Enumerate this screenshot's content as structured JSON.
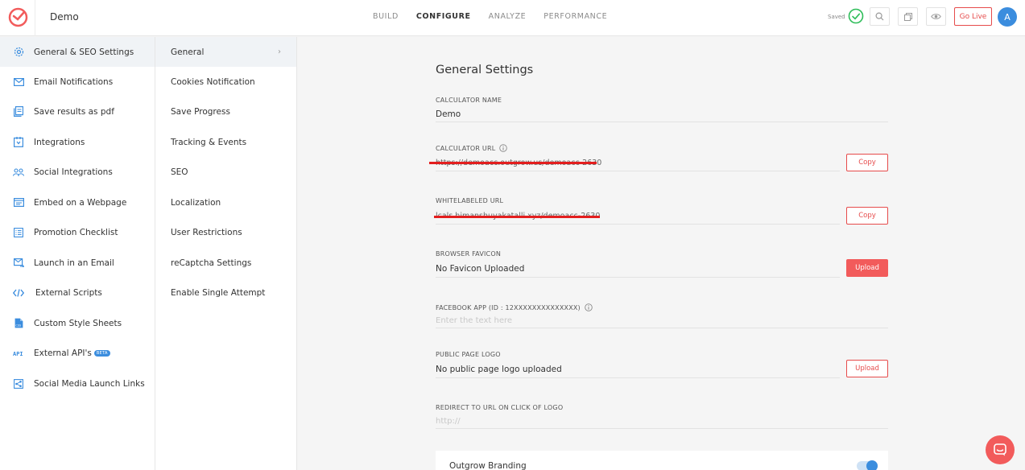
{
  "header": {
    "app_name": "Demo",
    "nav": [
      "BUILD",
      "CONFIGURE",
      "ANALYZE",
      "PERFORMANCE"
    ],
    "active_nav": "CONFIGURE",
    "saved": "Saved",
    "go_live": "Go Live",
    "avatar_initial": "A"
  },
  "sidebar": {
    "items": [
      {
        "label": "General & SEO Settings",
        "icon": "gear-icon"
      },
      {
        "label": "Email Notifications",
        "icon": "envelope-icon"
      },
      {
        "label": "Save results as pdf",
        "icon": "pdf-icon"
      },
      {
        "label": "Integrations",
        "icon": "integrations-icon"
      },
      {
        "label": "Social Integrations",
        "icon": "people-icon"
      },
      {
        "label": "Embed on a Webpage",
        "icon": "embed-icon"
      },
      {
        "label": "Promotion Checklist",
        "icon": "checklist-icon"
      },
      {
        "label": "Launch in an Email",
        "icon": "email-launch-icon"
      },
      {
        "label": "External Scripts",
        "icon": "code-icon"
      },
      {
        "label": "Custom Style Sheets",
        "icon": "css-file-icon"
      },
      {
        "label": "External API's",
        "icon": "api-icon",
        "badge": "BETA"
      },
      {
        "label": "Social Media Launch Links",
        "icon": "share-icon"
      }
    ]
  },
  "submenu": {
    "items": [
      "General",
      "Cookies Notification",
      "Save Progress",
      "Tracking & Events",
      "SEO",
      "Localization",
      "User Restrictions",
      "reCaptcha Settings",
      "Enable Single Attempt"
    ]
  },
  "main": {
    "title": "General Settings",
    "calculator_name": {
      "label": "CALCULATOR NAME",
      "value": "Demo"
    },
    "calculator_url": {
      "label": "CALCULATOR URL",
      "value": "https://demoacc.outgrow.us/demoacc-2630",
      "button": "Copy"
    },
    "whitelabeled_url": {
      "label": "WHITELABELED URL",
      "value": "lcals.himanshuyakatalli.xyz/demoacc-2630",
      "button": "Copy"
    },
    "favicon": {
      "label": "BROWSER FAVICON",
      "value": "No Favicon Uploaded",
      "button": "Upload"
    },
    "facebook_app": {
      "label": "FACEBOOK APP (ID : 12XXXXXXXXXXXXXX)",
      "placeholder": "Enter the text here"
    },
    "public_logo": {
      "label": "PUBLIC PAGE LOGO",
      "value": "No public page logo uploaded",
      "button": "Upload"
    },
    "redirect": {
      "label": "REDIRECT TO URL ON CLICK OF LOGO",
      "placeholder": "http://"
    },
    "branding": {
      "label": "Outgrow Branding",
      "enabled": true
    }
  },
  "colors": {
    "accent": "#e64b4b",
    "primary": "#3b8dde",
    "success": "#2ebd59"
  }
}
